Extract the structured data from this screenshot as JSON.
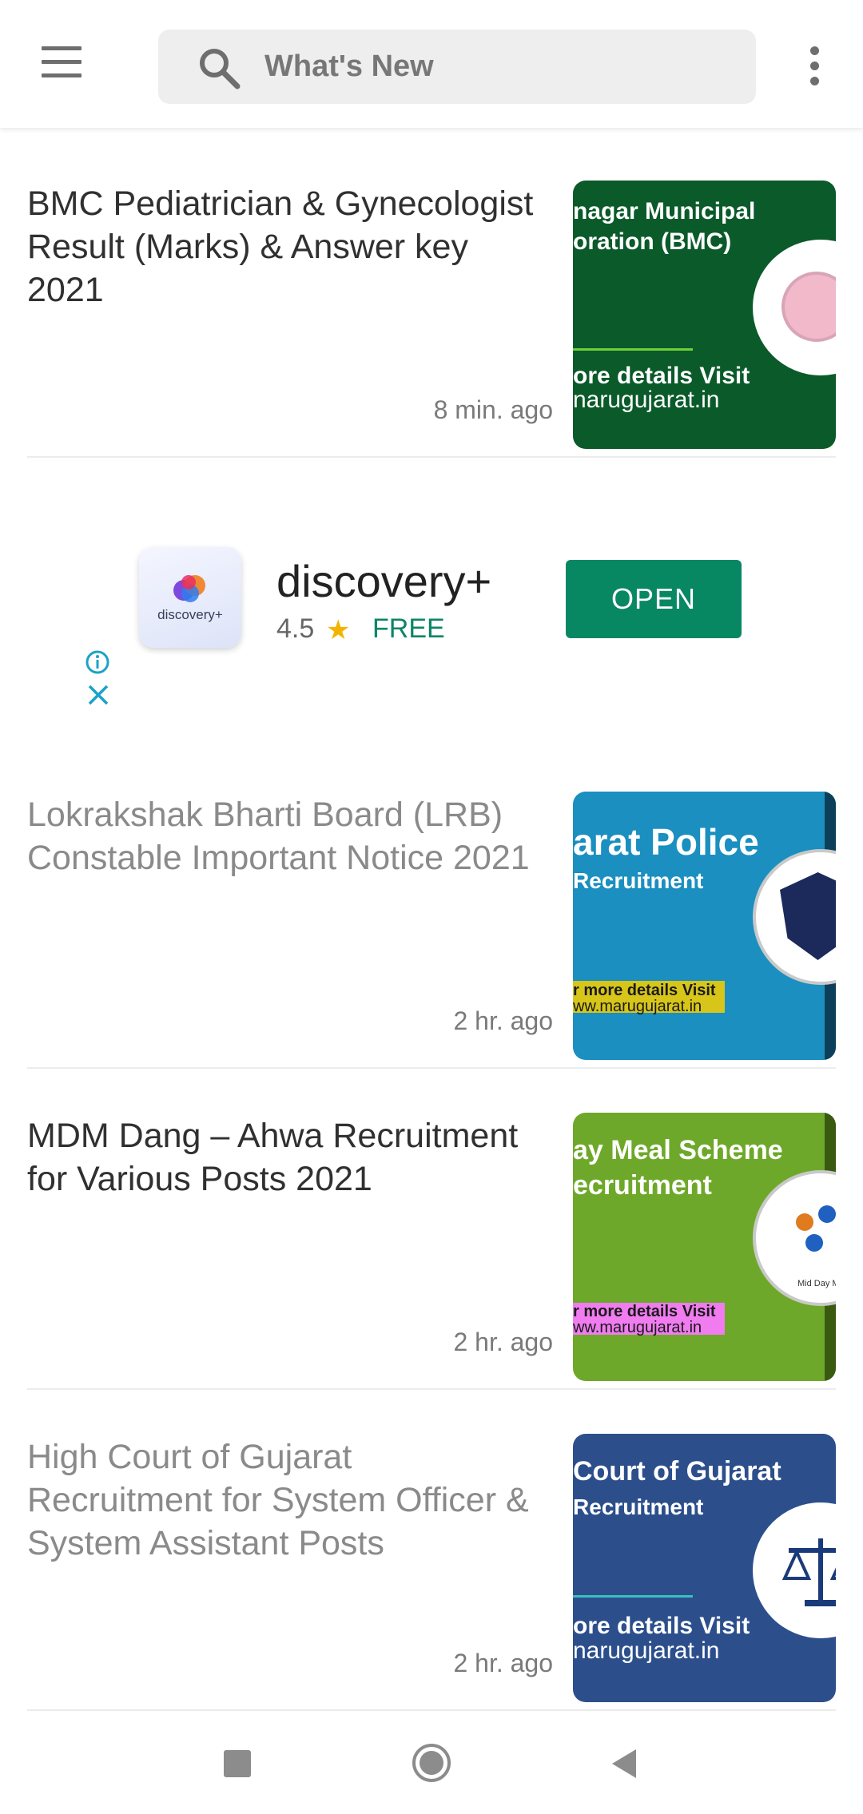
{
  "search": {
    "placeholder": "What's New"
  },
  "articles": [
    {
      "title": "BMC Pediatrician & Gynecologist Result (Marks) & Answer key 2021",
      "time": "8 min. ago",
      "read": false,
      "thumb": {
        "bg": "#0a5a2a",
        "line1": "nagar Municipal",
        "line2": "oration (BMC)",
        "line3": "ore details Visit",
        "line4": "narugujarat.in"
      }
    },
    {
      "title": "Lokrakshak Bharti Board (LRB) Constable Important Notice 2021",
      "time": "2 hr. ago",
      "read": true,
      "thumb": {
        "bg": "#1a8fc0",
        "line1": "arat Police",
        "line2": "Recruitment",
        "line3": "r more details Visit",
        "line4": "ww.marugujarat.in"
      }
    },
    {
      "title": "MDM Dang – Ahwa Recruitment for Various Posts 2021",
      "time": "2 hr. ago",
      "read": false,
      "thumb": {
        "bg": "#6ea82a",
        "line1": "ay Meal Scheme",
        "line2": "ecruitment",
        "line3": "r more details Visit",
        "line4": "ww.marugujarat.in",
        "line5": "Mid Day Me"
      }
    },
    {
      "title": "High Court of Gujarat Recruitment for System Officer & System Assistant Posts",
      "time": "2 hr. ago",
      "read": true,
      "thumb": {
        "bg": "#2c4f8c",
        "line1": "Court of Gujarat",
        "line2": "Recruitment",
        "line3": "ore details Visit",
        "line4": "narugujarat.in"
      }
    }
  ],
  "ad": {
    "app_name": "discovery+",
    "logo_label": "discovery+",
    "rating": "4.5",
    "price": "FREE",
    "button": "OPEN",
    "accent": "#088763"
  },
  "colors": {
    "accent": "#088763",
    "star": "#f2b400"
  },
  "icons": [
    "menu-icon",
    "search-icon",
    "more-vert-icon",
    "info-icon",
    "close-icon",
    "star-icon",
    "square-icon",
    "home-circle-icon",
    "back-triangle-icon"
  ]
}
